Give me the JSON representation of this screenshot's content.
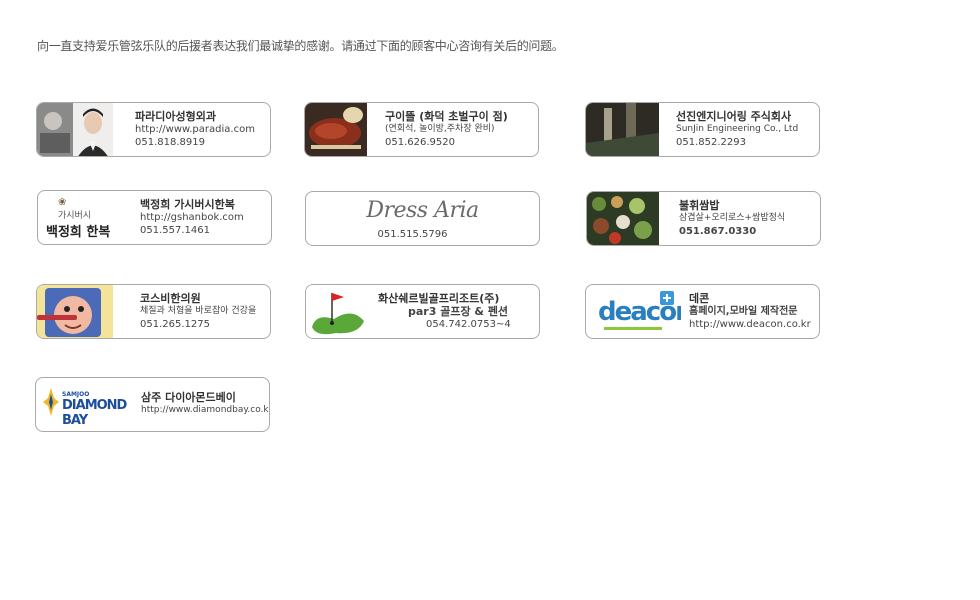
{
  "intro": "向一直支持爱乐管弦乐队的后援者表达我们最诚挚的感谢。请通过下面的顾客中心咨询有关后的问题。",
  "sponsors": [
    {
      "name": "파라디아성형외과",
      "line1": "http://www.paradia.com",
      "line2": "051.818.8919"
    },
    {
      "name": "구이뜰 (화덕 초벌구이 점)",
      "line1": "(연회석, 놀이방,주차장 완비)",
      "line2": "051.626.9520"
    },
    {
      "name": "선진엔지니어링 주식회사",
      "line1": "SunJin Engineering Co., Ltd",
      "line2": "051.852.2293"
    },
    {
      "name": "백정희 가시버시한복",
      "line1": "http://gshanbok.com",
      "line2": "051.557.1461",
      "logo_small": "가시버시",
      "logo_big": "백정희 한복"
    },
    {
      "name": "",
      "line1": "",
      "line2": "051.515.5796",
      "logo": "Dress Aria"
    },
    {
      "name": "불휘쌈밥",
      "line1": "삼겹살+오리로스+쌈밥정식",
      "line2": "051.867.0330"
    },
    {
      "name": "코스비한의원",
      "line1": "체질과 처형을 바로잡아 건강을",
      "line2": "051.265.1275"
    },
    {
      "name": "화산쉐르빌골프리조트(주)",
      "line1": "par3 골프장 & 펜션",
      "line2": "054.742.0753~4"
    },
    {
      "name": "데콘",
      "line1": "홈페이지,모바일 제작전문",
      "line2": "http://www.deacon.co.kr",
      "logo": "deacon"
    },
    {
      "name": "삼주 다이아몬드베이",
      "line1": "http://www.diamondbay.co.kr",
      "line2": "",
      "logo_small": "SAMJOO",
      "logo_big": "DIAMOND BAY"
    }
  ]
}
